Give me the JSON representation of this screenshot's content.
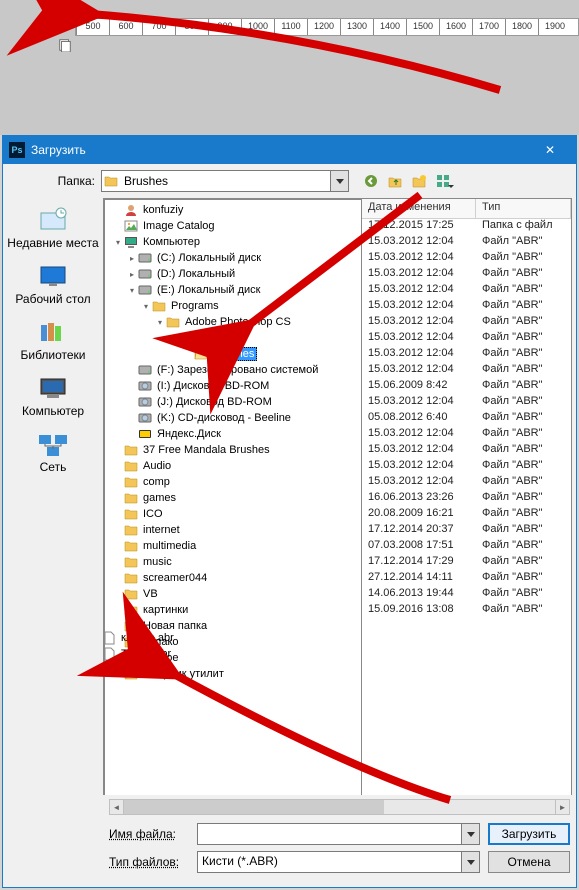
{
  "ps": {
    "ruler_marks": [
      "500",
      "600",
      "700",
      "800",
      "900",
      "1000",
      "1100",
      "1200",
      "1300",
      "1400",
      "1500",
      "1600",
      "1700",
      "1800",
      "1900"
    ]
  },
  "dialog": {
    "title": "Загрузить",
    "close_glyph": "✕",
    "folder_label": "Папка:",
    "folder_value": "Brushes",
    "sidebar": [
      {
        "label": "Недавние места",
        "icon": "recent"
      },
      {
        "label": "Рабочий стол",
        "icon": "desktop"
      },
      {
        "label": "Библиотеки",
        "icon": "libraries"
      },
      {
        "label": "Компьютер",
        "icon": "computer"
      },
      {
        "label": "Сеть",
        "icon": "network"
      }
    ],
    "cols": {
      "date": "Дата изменения",
      "type": "Тип"
    },
    "tree": [
      {
        "d": 0,
        "exp": "",
        "icon": "user",
        "label": "konfuziy"
      },
      {
        "d": 0,
        "exp": "",
        "icon": "imgcat",
        "label": "Image Catalog"
      },
      {
        "d": 0,
        "exp": "-",
        "icon": "computer",
        "label": "Компьютер"
      },
      {
        "d": 1,
        "exp": "+",
        "icon": "disk",
        "label": "(C:) Локальный диск"
      },
      {
        "d": 1,
        "exp": "+",
        "icon": "disk",
        "label": "(D:) Локальный"
      },
      {
        "d": 1,
        "exp": "-",
        "icon": "disk",
        "label": "(E:) Локальный диск"
      },
      {
        "d": 2,
        "exp": "-",
        "icon": "folder",
        "label": "Programs"
      },
      {
        "d": 3,
        "exp": "-",
        "icon": "folder",
        "label": "Adobe Photoshop CS"
      },
      {
        "d": 4,
        "exp": "-",
        "icon": "folder",
        "label": "Presets"
      },
      {
        "d": 5,
        "exp": "",
        "icon": "folder-open",
        "label": "Brushes",
        "sel": true
      },
      {
        "d": 1,
        "exp": "",
        "icon": "disk",
        "label": "(F:) Зарезервировано системой"
      },
      {
        "d": 1,
        "exp": "",
        "icon": "bd",
        "label": "(I:) Дисковод BD-ROM"
      },
      {
        "d": 1,
        "exp": "",
        "icon": "bd",
        "label": "(J:) Дисковод BD-ROM"
      },
      {
        "d": 1,
        "exp": "",
        "icon": "bd",
        "label": "(K:) CD-дисковод - Beeline"
      },
      {
        "d": 1,
        "exp": "",
        "icon": "ydisk",
        "label": "Яндекс.Диск"
      },
      {
        "d": 0,
        "exp": "",
        "icon": "folder",
        "label": "37 Free Mandala Brushes"
      },
      {
        "d": 0,
        "exp": "",
        "icon": "folder",
        "label": "Audio"
      },
      {
        "d": 0,
        "exp": "",
        "icon": "folder",
        "label": "comp"
      },
      {
        "d": 0,
        "exp": "",
        "icon": "folder",
        "label": "games"
      },
      {
        "d": 0,
        "exp": "",
        "icon": "folder",
        "label": "ICO"
      },
      {
        "d": 0,
        "exp": "",
        "icon": "folder",
        "label": "internet"
      },
      {
        "d": 0,
        "exp": "",
        "icon": "folder",
        "label": "multimedia"
      },
      {
        "d": 0,
        "exp": "",
        "icon": "folder",
        "label": "music"
      },
      {
        "d": 0,
        "exp": "",
        "icon": "folder",
        "label": "screamer044"
      },
      {
        "d": 0,
        "exp": "",
        "icon": "folder",
        "label": "VB"
      },
      {
        "d": 0,
        "exp": "",
        "icon": "folder",
        "label": "картинки"
      },
      {
        "d": 0,
        "exp": "",
        "icon": "folder",
        "label": "Новая папка"
      },
      {
        "d": 0,
        "exp": "",
        "icon": "folder",
        "label": "облако"
      },
      {
        "d": 0,
        "exp": "",
        "icon": "folder",
        "label": "разное"
      },
      {
        "d": 0,
        "exp": "",
        "icon": "folder",
        "label": "Сборник утилит"
      }
    ],
    "rows": [
      {
        "date": "17.12.2015 17:25",
        "type": "Папка с файл"
      },
      {
        "date": "15.03.2012 12:04",
        "type": "Файл \"ABR\""
      },
      {
        "date": "15.03.2012 12:04",
        "type": "Файл \"ABR\""
      },
      {
        "date": "15.03.2012 12:04",
        "type": "Файл \"ABR\""
      },
      {
        "date": "15.03.2012 12:04",
        "type": "Файл \"ABR\""
      },
      {
        "date": "15.03.2012 12:04",
        "type": "Файл \"ABR\""
      },
      {
        "date": "15.03.2012 12:04",
        "type": "Файл \"ABR\""
      },
      {
        "date": "15.03.2012 12:04",
        "type": "Файл \"ABR\""
      },
      {
        "date": "15.03.2012 12:04",
        "type": "Файл \"ABR\""
      },
      {
        "date": "15.03.2012 12:04",
        "type": "Файл \"ABR\""
      },
      {
        "date": "15.06.2009 8:42",
        "type": "Файл \"ABR\""
      },
      {
        "date": "15.03.2012 12:04",
        "type": "Файл \"ABR\""
      },
      {
        "date": "05.08.2012 6:40",
        "type": "Файл \"ABR\""
      },
      {
        "date": "15.03.2012 12:04",
        "type": "Файл \"ABR\""
      },
      {
        "date": "15.03.2012 12:04",
        "type": "Файл \"ABR\""
      },
      {
        "date": "15.03.2012 12:04",
        "type": "Файл \"ABR\""
      },
      {
        "date": "15.03.2012 12:04",
        "type": "Файл \"ABR\""
      },
      {
        "date": "16.06.2013 23:26",
        "type": "Файл \"ABR\""
      },
      {
        "date": "20.08.2009 16:21",
        "type": "Файл \"ABR\""
      },
      {
        "date": "17.12.2014 20:37",
        "type": "Файл \"ABR\""
      },
      {
        "date": "07.03.2008 17:51",
        "type": "Файл \"ABR\""
      },
      {
        "date": "17.12.2014 17:29",
        "type": "Файл \"ABR\""
      },
      {
        "date": "27.12.2014 14:11",
        "type": "Файл \"ABR\""
      },
      {
        "date": "14.06.2013 19:44",
        "type": "Файл \"ABR\""
      },
      {
        "date": "15.09.2016 13:08",
        "type": "Файл \"ABR\""
      }
    ],
    "extra_files": [
      {
        "name": "клякса.abr"
      },
      {
        "name": "Туман.abr"
      }
    ],
    "filename_label": "Имя файла:",
    "filename_value": "",
    "filetype_label": "Тип файлов:",
    "filetype_value": "Кисти (*.ABR)",
    "load_btn": "Загрузить",
    "cancel_btn": "Отмена"
  }
}
